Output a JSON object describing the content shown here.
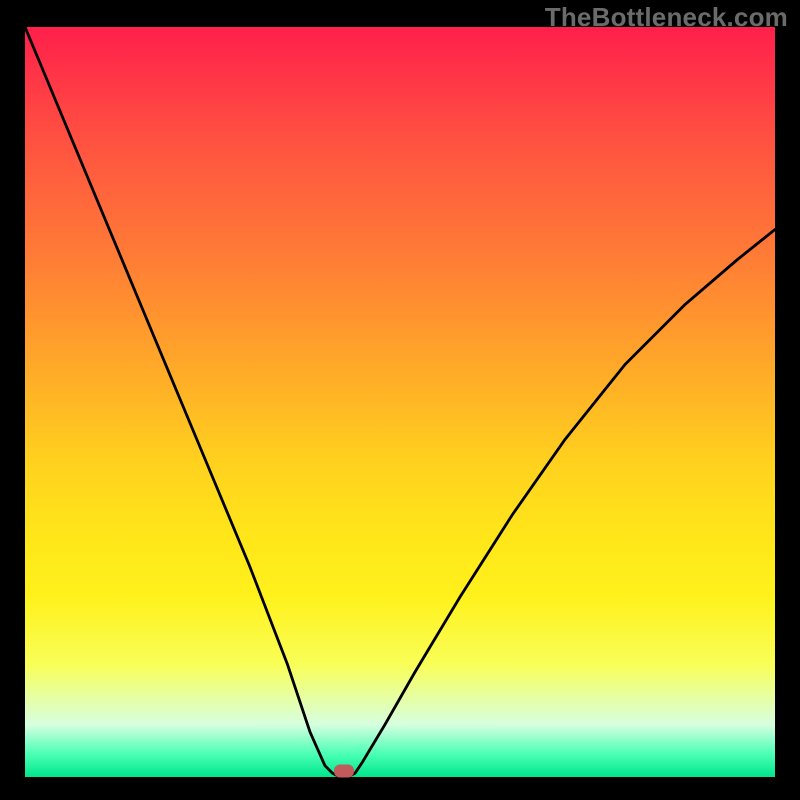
{
  "watermark": "TheBottleneck.com",
  "chart_data": {
    "type": "line",
    "title": "",
    "xlabel": "",
    "ylabel": "",
    "xlim": [
      0,
      100
    ],
    "ylim": [
      0,
      100
    ],
    "series": [
      {
        "name": "curve",
        "x": [
          0,
          5,
          10,
          15,
          20,
          25,
          30,
          35,
          38,
          40,
          41,
          42,
          43,
          44,
          45,
          48,
          52,
          58,
          65,
          72,
          80,
          88,
          95,
          100
        ],
        "y": [
          100,
          88,
          76,
          64,
          52,
          40,
          28,
          15,
          6,
          1.5,
          0.5,
          0,
          0,
          0.5,
          2,
          7,
          14,
          24,
          35,
          45,
          55,
          63,
          69,
          73
        ]
      }
    ],
    "marker": {
      "x": 42.5,
      "y": 0.8
    },
    "gradient_stops": [
      {
        "pos": 0,
        "color": "#ff1f4b"
      },
      {
        "pos": 50,
        "color": "#ffc81f"
      },
      {
        "pos": 85,
        "color": "#f9ff58"
      },
      {
        "pos": 100,
        "color": "#00e68c"
      }
    ]
  }
}
